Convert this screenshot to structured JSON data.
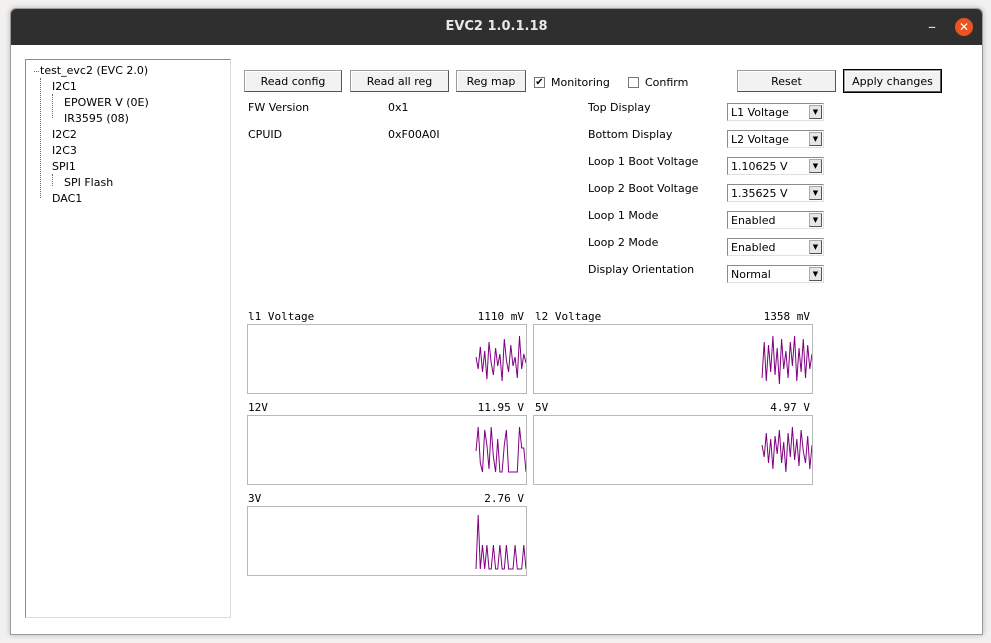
{
  "window": {
    "title": "EVC2 1.0.1.18",
    "minimize_glyph": "–",
    "close_glyph": "✕"
  },
  "tree": {
    "root": "test_evc2 (EVC 2.0)",
    "i2c1": "I2C1",
    "epower": "EPOWER V (0E)",
    "ir3595": "IR3595 (08)",
    "i2c2": "I2C2",
    "i2c3": "I2C3",
    "spi1": "SPI1",
    "spiflash": "SPI Flash",
    "dac1": "DAC1"
  },
  "toolbar": {
    "read_config": "Read config",
    "read_all_reg": "Read all reg",
    "reg_map": "Reg map",
    "monitoring": "Monitoring",
    "monitoring_checked": true,
    "confirm": "Confirm",
    "confirm_checked": false,
    "reset": "Reset",
    "apply": "Apply changes"
  },
  "info": {
    "fw_label": "FW Version",
    "fw_value": "0x1",
    "cpuid_label": "CPUID",
    "cpuid_value": "0xF00A0I"
  },
  "settings": {
    "top_display": {
      "label": "Top Display",
      "value": "L1 Voltage"
    },
    "bottom_display": {
      "label": "Bottom Display",
      "value": "L2 Voltage"
    },
    "loop1_boot": {
      "label": "Loop 1 Boot Voltage",
      "value": "1.10625 V"
    },
    "loop2_boot": {
      "label": "Loop 2 Boot Voltage",
      "value": "1.35625 V"
    },
    "loop1_mode": {
      "label": "Loop 1 Mode",
      "value": "Enabled"
    },
    "loop2_mode": {
      "label": "Loop 2 Mode",
      "value": "Enabled"
    },
    "orientation": {
      "label": "Display Orientation",
      "value": "Normal"
    }
  },
  "graphs": {
    "l1": {
      "label": "l1 Voltage",
      "reading": "1110 mV",
      "samples": [
        0.55,
        0.35,
        0.72,
        0.3,
        0.65,
        0.18,
        0.8,
        0.45,
        0.25,
        0.7,
        0.4,
        0.6,
        0.15,
        0.85,
        0.5,
        0.3,
        0.75,
        0.4,
        0.55,
        0.2,
        0.9,
        0.35,
        0.6,
        0.45
      ]
    },
    "l2": {
      "label": "l2 Voltage",
      "reading": "1358 mV",
      "samples": [
        0.2,
        0.8,
        0.15,
        0.75,
        0.3,
        0.9,
        0.25,
        0.7,
        0.1,
        0.85,
        0.35,
        0.65,
        0.2,
        0.8,
        0.4,
        0.9,
        0.15,
        0.7,
        0.3,
        0.85,
        0.2,
        0.75,
        0.35,
        0.6
      ]
    },
    "v12": {
      "label": "12V",
      "reading": "11.95 V",
      "samples": [
        0.5,
        0.9,
        0.3,
        0.15,
        0.85,
        0.6,
        0.2,
        0.9,
        0.4,
        0.15,
        0.7,
        0.15,
        0.15,
        0.6,
        0.85,
        0.15,
        0.15,
        0.15,
        0.15,
        0.15,
        0.9,
        0.55,
        0.55,
        0.15
      ]
    },
    "v5": {
      "label": "5V",
      "reading": "4.97 V",
      "samples": [
        0.6,
        0.4,
        0.8,
        0.3,
        0.7,
        0.2,
        0.75,
        0.45,
        0.85,
        0.3,
        0.65,
        0.15,
        0.8,
        0.4,
        0.9,
        0.35,
        0.7,
        0.25,
        0.85,
        0.5,
        0.3,
        0.75,
        0.2,
        0.6
      ]
    },
    "v3": {
      "label": "3V",
      "reading": "2.76 V",
      "samples": [
        0.05,
        0.95,
        0.05,
        0.45,
        0.05,
        0.45,
        0.05,
        0.05,
        0.45,
        0.05,
        0.05,
        0.45,
        0.05,
        0.05,
        0.45,
        0.05,
        0.05,
        0.05,
        0.45,
        0.05,
        0.05,
        0.05,
        0.45,
        0.05
      ]
    }
  },
  "colors": {
    "trace": "#800080",
    "accent_close": "#e95420"
  }
}
